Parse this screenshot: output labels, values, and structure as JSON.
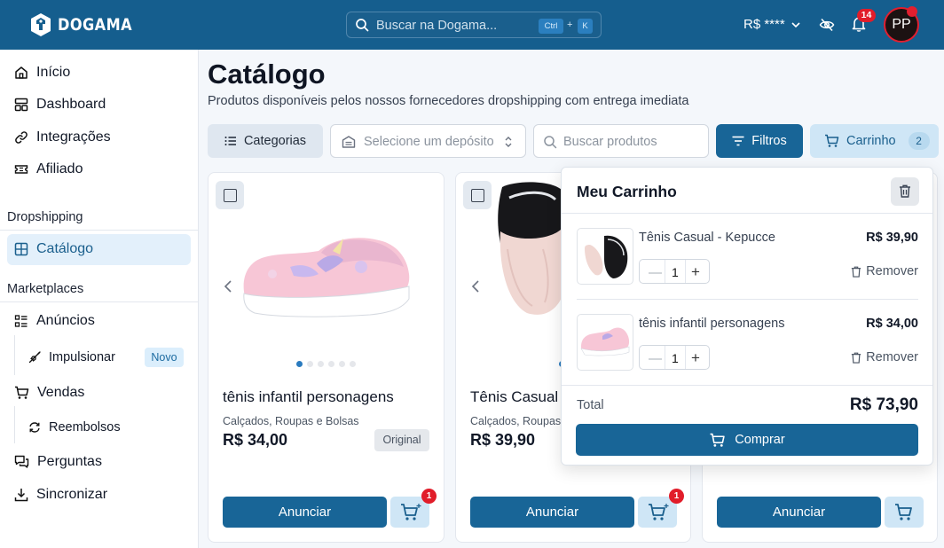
{
  "header": {
    "brand": "DOGAMA",
    "search_placeholder": "Buscar na Dogama...",
    "shortcut_ctrl": "Ctrl",
    "shortcut_plus": "+",
    "shortcut_key": "K",
    "balance": "R$ ****",
    "notifications_count": "14",
    "avatar_initials": "PP"
  },
  "sidebar": {
    "items": [
      {
        "label": "Início",
        "icon": "home-icon"
      },
      {
        "label": "Dashboard",
        "icon": "dashboard-icon"
      },
      {
        "label": "Integrações",
        "icon": "link-icon"
      },
      {
        "label": "Afiliado",
        "icon": "ticket-icon"
      }
    ],
    "section_dropshipping": "Dropshipping",
    "catalogo": "Catálogo",
    "section_marketplaces": "Marketplaces",
    "anuncios": "Anúncios",
    "impulsionar": "Impulsionar",
    "novo_badge": "Novo",
    "vendas": "Vendas",
    "reembolsos": "Reembolsos",
    "perguntas": "Perguntas",
    "sincronizar": "Sincronizar"
  },
  "page": {
    "title": "Catálogo",
    "subtitle": "Produtos disponíveis pelos nossos fornecedores dropshipping com entrega imediata"
  },
  "toolbar": {
    "categorias": "Categorias",
    "deposito_placeholder": "Selecione um depósito",
    "buscar_placeholder": "Buscar produtos",
    "filtros": "Filtros",
    "carrinho": "Carrinho",
    "carrinho_count": "2"
  },
  "products": [
    {
      "name": "tênis infantil personagens",
      "category": "Calçados, Roupas e Bolsas",
      "price": "R$ 34,00",
      "badge": "Original",
      "action": "Anunciar",
      "cart_badge": "1"
    },
    {
      "name": "Tênis Casual - Kepucce",
      "category": "Calçados, Roupas e Bolsas",
      "price": "R$ 39,90",
      "action": "Anunciar",
      "cart_badge": "1"
    },
    {
      "action": "Anunciar"
    }
  ],
  "cart_panel": {
    "title": "Meu Carrinho",
    "items": [
      {
        "name": "Tênis Casual - Kepucce",
        "price": "R$ 39,90",
        "qty": "1",
        "remove": "Remover"
      },
      {
        "name": "tênis infantil personagens",
        "price": "R$ 34,00",
        "qty": "1",
        "remove": "Remover"
      }
    ],
    "total_label": "Total",
    "total_value": "R$ 73,90",
    "buy_label": "Comprar"
  },
  "colors": {
    "primary": "#186597",
    "header": "#155e8e",
    "accent_light": "#cfe6f6",
    "alert": "#e11d2a"
  }
}
